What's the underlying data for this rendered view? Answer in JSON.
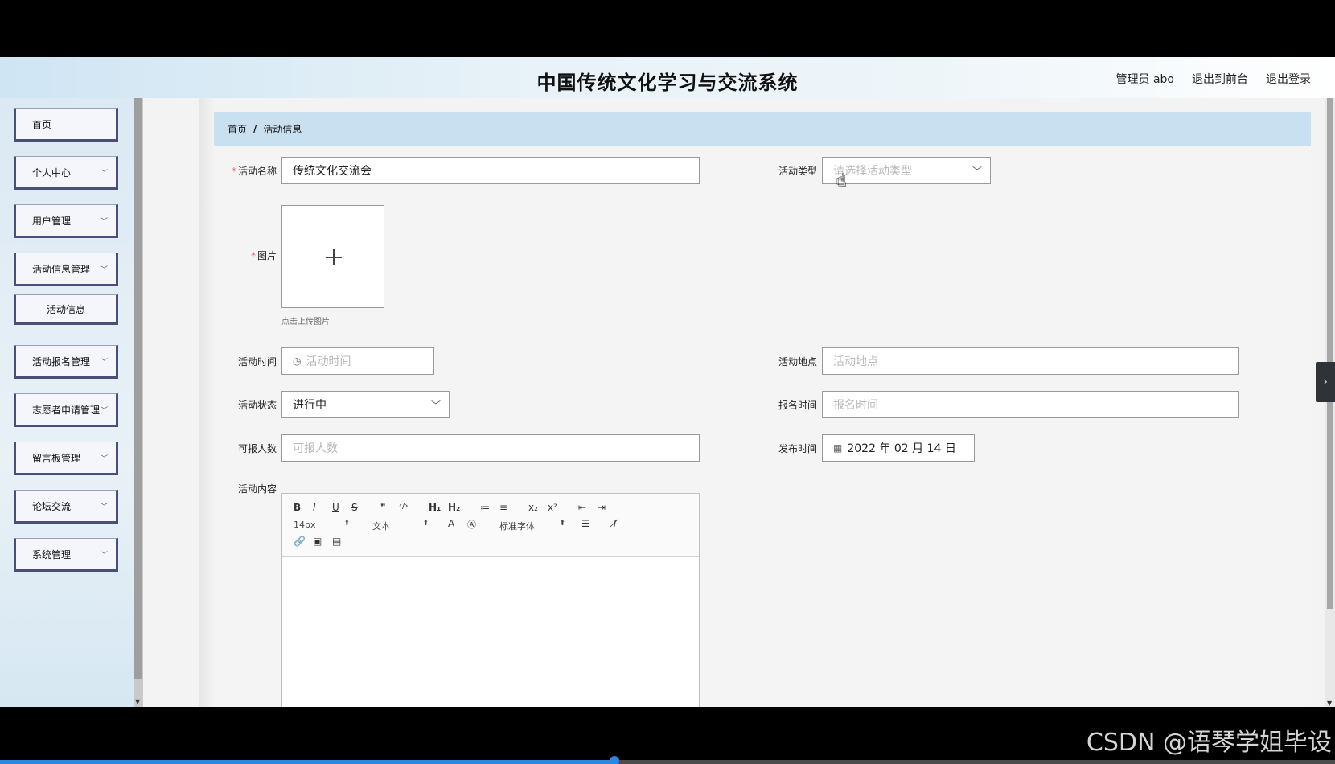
{
  "header": {
    "title": "中国传统文化学习与交流系统",
    "user": "管理员 abo",
    "to_front": "退出到前台",
    "logout": "退出登录"
  },
  "sidebar": {
    "items": [
      {
        "label": "首页"
      },
      {
        "label": "个人中心"
      },
      {
        "label": "用户管理"
      },
      {
        "label": "活动信息管理"
      },
      {
        "label": "活动信息"
      },
      {
        "label": "活动报名管理"
      },
      {
        "label": "志愿者申请管理"
      },
      {
        "label": "留言板管理"
      },
      {
        "label": "论坛交流"
      },
      {
        "label": "系统管理"
      }
    ]
  },
  "breadcrumb": {
    "home": "首页",
    "separator": "/",
    "current": "活动信息"
  },
  "form": {
    "name": {
      "label": "活动名称",
      "value": "传统文化交流会"
    },
    "type": {
      "label": "活动类型",
      "placeholder": "请选择活动类型"
    },
    "image": {
      "label": "图片",
      "tip": "点击上传图片"
    },
    "time": {
      "label": "活动时间",
      "placeholder": "活动时间"
    },
    "place": {
      "label": "活动地点",
      "placeholder": "活动地点"
    },
    "status": {
      "label": "活动状态",
      "value": "进行中"
    },
    "signup_time": {
      "label": "报名时间",
      "placeholder": "报名时间"
    },
    "capacity": {
      "label": "可报人数",
      "placeholder": "可报人数"
    },
    "publish_time": {
      "label": "发布时间",
      "value": "2022 年 02 月 14 日"
    },
    "content": {
      "label": "活动内容"
    }
  },
  "editor": {
    "toolbar_row1": [
      "B",
      "I",
      "U",
      "S",
      "❞",
      "‹/›",
      "H₁",
      "H₂",
      "≔",
      "≡",
      "x₂",
      "x²",
      "⇤",
      "⇥"
    ],
    "font_size": "14px",
    "paragraph": "文本",
    "font_family": "标准字体"
  },
  "watermark": "CSDN @语琴学姐毕设",
  "video_progress": 0.46
}
